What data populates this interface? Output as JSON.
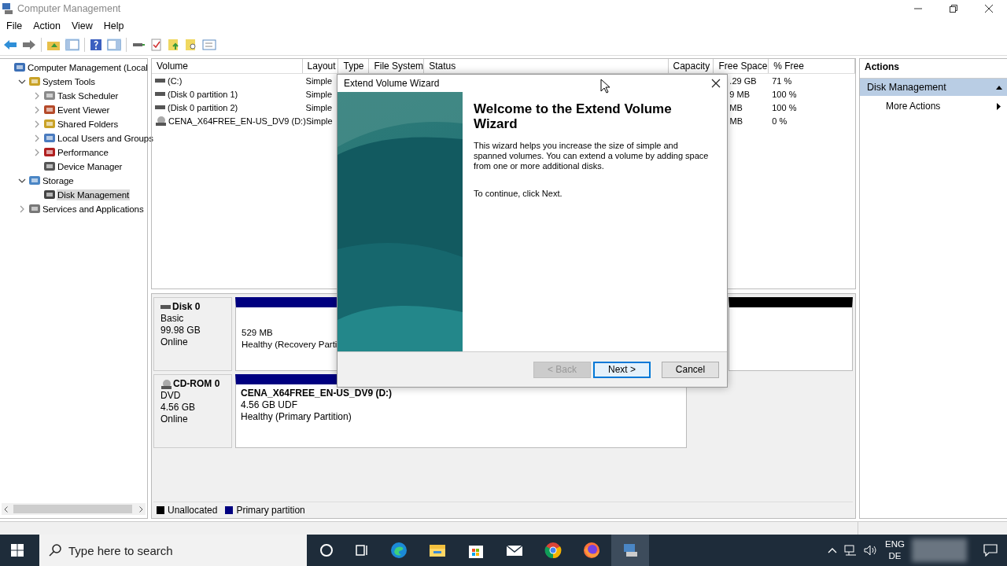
{
  "window": {
    "title": "Computer Management"
  },
  "menu": [
    "File",
    "Action",
    "View",
    "Help"
  ],
  "tree": [
    {
      "label": "Computer Management (Local",
      "selected": false,
      "children": [
        {
          "label": "System Tools",
          "expanded": true,
          "selected": false,
          "children": [
            {
              "label": "Task Scheduler",
              "expanded": false,
              "selected": false
            },
            {
              "label": "Event Viewer",
              "expanded": false,
              "selected": false
            },
            {
              "label": "Shared Folders",
              "expanded": false,
              "selected": false
            },
            {
              "label": "Local Users and Groups",
              "expanded": false,
              "selected": false
            },
            {
              "label": "Performance",
              "expanded": false,
              "selected": false
            },
            {
              "label": "Device Manager",
              "selected": false
            }
          ]
        },
        {
          "label": "Storage",
          "expanded": true,
          "selected": false,
          "children": [
            {
              "label": "Disk Management",
              "selected": true
            }
          ]
        },
        {
          "label": "Services and Applications",
          "expanded": false,
          "selected": false
        }
      ]
    }
  ],
  "table": {
    "columns": [
      "Volume",
      "Layout",
      "Type",
      "File System",
      "Status",
      "Capacity",
      "Free Space",
      "% Free"
    ],
    "rows": [
      {
        "volume": "(C:)",
        "kind": "disk",
        "layout": "Simple",
        "free_space": ".29 GB",
        "percent_free": "71 %"
      },
      {
        "volume": "(Disk 0 partition 1)",
        "kind": "disk",
        "layout": "Simple",
        "free_space": "9 MB",
        "percent_free": "100 %"
      },
      {
        "volume": "(Disk 0 partition 2)",
        "kind": "disk",
        "layout": "Simple",
        "free_space": "MB",
        "percent_free": "100 %"
      },
      {
        "volume": "CENA_X64FREE_EN-US_DV9 (D:)",
        "kind": "cd",
        "layout": "Simple",
        "free_space": "MB",
        "percent_free": "0 %"
      }
    ]
  },
  "disks": [
    {
      "name": "Disk 0",
      "kind": "disk",
      "type": "Basic",
      "size": "99.98 GB",
      "status": "Online",
      "partitions": [
        {
          "kind": "primary",
          "lines": [
            "529 MB",
            "Healthy (Recovery Parti"
          ]
        },
        {
          "kind": "unallocated"
        }
      ]
    },
    {
      "name": "CD-ROM 0",
      "kind": "cd",
      "type": "DVD",
      "size": "4.56 GB",
      "status": "Online",
      "partitions": [
        {
          "kind": "primary",
          "title": "CENA_X64FREE_EN-US_DV9  (D:)",
          "lines": [
            "4.56 GB UDF",
            "Healthy (Primary Partition)"
          ]
        }
      ]
    }
  ],
  "legend": [
    {
      "label": "Unallocated",
      "color": "#000000"
    },
    {
      "label": "Primary partition",
      "color": "#000080"
    }
  ],
  "actions": {
    "header": "Actions",
    "items": [
      {
        "label": "Disk Management",
        "kind": "section"
      },
      {
        "label": "More Actions",
        "kind": "item"
      }
    ]
  },
  "dialog": {
    "title": "Extend Volume Wizard",
    "heading": "Welcome to the Extend Volume Wizard",
    "body": "This wizard helps you increase the size of simple and spanned volumes. You can extend a volume  by adding space from one or more additional disks.",
    "instruction": "To continue, click Next.",
    "buttons": [
      {
        "label": "< Back",
        "disabled": true,
        "default": false
      },
      {
        "label": "Next >",
        "disabled": false,
        "default": true
      },
      {
        "label": "Cancel",
        "disabled": false,
        "default": false
      }
    ]
  },
  "taskbar": {
    "search_placeholder": "Type here to search",
    "language": [
      "ENG",
      "DE"
    ]
  }
}
